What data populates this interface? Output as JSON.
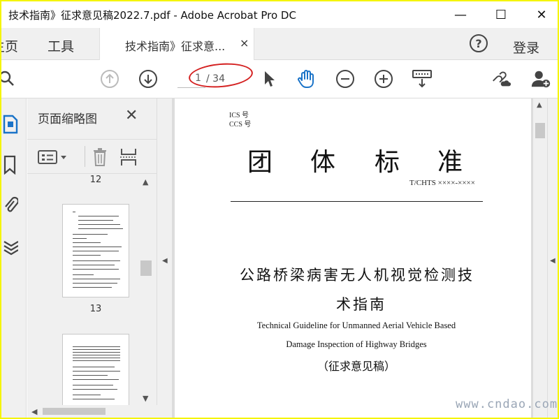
{
  "window": {
    "title": "技术指南》征求意见稿2022.7.pdf - Adobe Acrobat Pro DC",
    "minimize_glyph": "—",
    "maximize_glyph": "☐",
    "close_glyph": "✕"
  },
  "menubar": {
    "home_label": "主页",
    "tools_label": "工具",
    "doc_tab_label": "技术指南》征求意...",
    "doc_tab_close": "×",
    "help_label": "?",
    "login_label": "登录"
  },
  "toolbar": {
    "current_page": "1",
    "total_pages": "/ 34",
    "icons": [
      "search-icon",
      "prev-page-icon",
      "next-page-icon",
      "select-cursor-icon",
      "hand-tool-icon",
      "zoom-out-icon",
      "zoom-in-icon",
      "keyboard-icon",
      "link-cloud-icon",
      "add-user-icon"
    ]
  },
  "thumbnails": {
    "title": "页面缩略图",
    "close": "✕",
    "items": [
      {
        "page": "12"
      },
      {
        "page": "13"
      }
    ]
  },
  "document": {
    "ics_label": "ICS 号",
    "ccs_label": "CCS 号",
    "main_title_chars": [
      "团",
      "体",
      "标",
      "准"
    ],
    "standard_number": "T/CHTS ××××-××××",
    "cn_title_line1": "公路桥梁病害无人机视觉检测技",
    "cn_title_line2": "术指南",
    "en_title_line1": "Technical Guideline for Unmanned Aerial Vehicle Based",
    "en_title_line2": "Damage Inspection of Highway Bridges",
    "cn_subtitle": "（征求意见稿）"
  },
  "watermark": "www.cndao.com",
  "colors": {
    "accent_blue": "#1a73c8",
    "annotation_red": "#d42020",
    "frame_yellow": "#f5f500"
  }
}
